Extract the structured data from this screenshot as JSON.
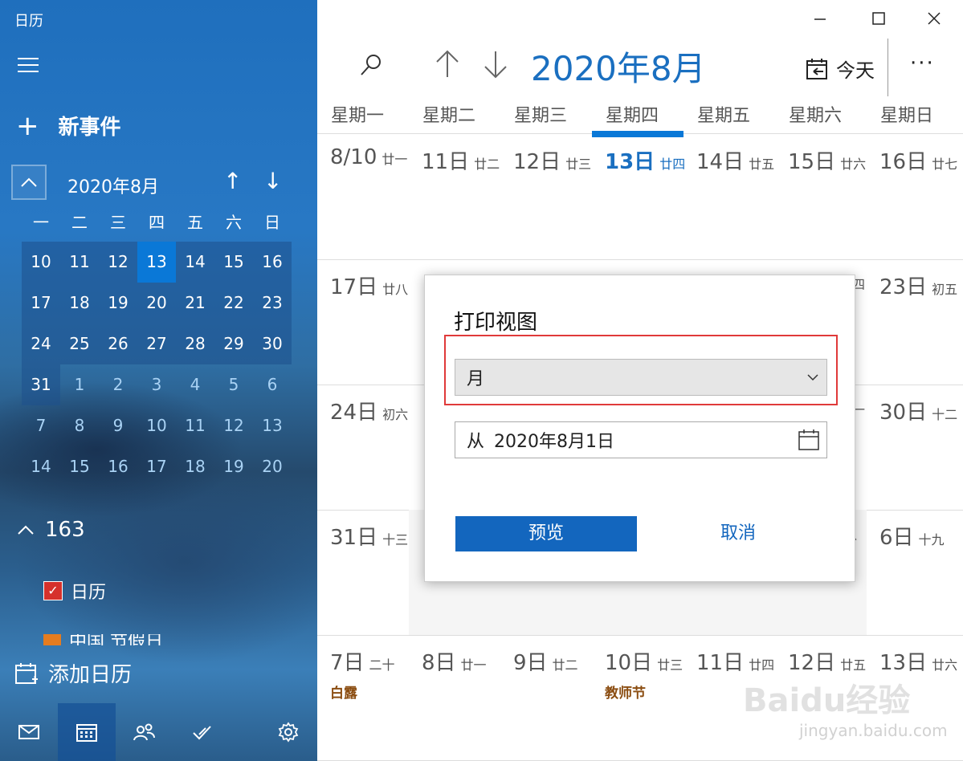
{
  "app": {
    "title": "日历"
  },
  "sidebar": {
    "new_event": "新事件",
    "mini_calendar": {
      "month_label": "2020年8月",
      "weekdays": [
        "一",
        "二",
        "三",
        "四",
        "五",
        "六",
        "日"
      ],
      "rows": [
        [
          "10",
          "11",
          "12",
          "13",
          "14",
          "15",
          "16"
        ],
        [
          "17",
          "18",
          "19",
          "20",
          "21",
          "22",
          "23"
        ],
        [
          "24",
          "25",
          "26",
          "27",
          "28",
          "29",
          "30"
        ],
        [
          "31",
          "1",
          "2",
          "3",
          "4",
          "5",
          "6"
        ],
        [
          "7",
          "8",
          "9",
          "10",
          "11",
          "12",
          "13"
        ],
        [
          "14",
          "15",
          "16",
          "17",
          "18",
          "19",
          "20"
        ]
      ]
    },
    "account": "163",
    "calendars": [
      {
        "name": "日历",
        "checked": true,
        "color": "#d6312c"
      },
      {
        "name": "中国 节假日",
        "checked": true,
        "color": "#e57c1f"
      }
    ],
    "add_calendar": "添加日历"
  },
  "header": {
    "month_title": "2020年8月",
    "today_label": "今天"
  },
  "weekdays": [
    "星期一",
    "星期二",
    "星期三",
    "星期四",
    "星期五",
    "星期六",
    "星期日"
  ],
  "weeks": [
    [
      {
        "d": "8/10",
        "l": "廿一"
      },
      {
        "d": "11日",
        "l": "廿二"
      },
      {
        "d": "12日",
        "l": "廿三"
      },
      {
        "d": "13日",
        "l": "廿四"
      },
      {
        "d": "14日",
        "l": "廿五"
      },
      {
        "d": "15日",
        "l": "廿六"
      },
      {
        "d": "16日",
        "l": "廿七"
      }
    ],
    [
      {
        "d": "17日",
        "l": "廿八"
      },
      {
        "d": "",
        "l": ""
      },
      {
        "d": "",
        "l": ""
      },
      {
        "d": "",
        "l": ""
      },
      {
        "d": "",
        "l": ""
      },
      {
        "d": "",
        "l": "四"
      },
      {
        "d": "23日",
        "l": "初五"
      }
    ],
    [
      {
        "d": "24日",
        "l": "初六"
      },
      {
        "d": "",
        "l": ""
      },
      {
        "d": "",
        "l": ""
      },
      {
        "d": "",
        "l": ""
      },
      {
        "d": "",
        "l": ""
      },
      {
        "d": "",
        "l": "一"
      },
      {
        "d": "30日",
        "l": "十二"
      }
    ],
    [
      {
        "d": "31日",
        "l": "十三"
      },
      {
        "d": "",
        "l": ""
      },
      {
        "d": "",
        "l": ""
      },
      {
        "d": "",
        "l": ""
      },
      {
        "d": "",
        "l": ""
      },
      {
        "d": "",
        "l": "、"
      },
      {
        "d": "6日",
        "l": "十九"
      }
    ],
    [
      {
        "d": "7日",
        "l": "二十",
        "h": "白露"
      },
      {
        "d": "8日",
        "l": "廿一"
      },
      {
        "d": "9日",
        "l": "廿二"
      },
      {
        "d": "10日",
        "l": "廿三",
        "h": "教师节"
      },
      {
        "d": "11日",
        "l": "廿四"
      },
      {
        "d": "12日",
        "l": "廿五"
      },
      {
        "d": "13日",
        "l": "廿六"
      }
    ]
  ],
  "dialog": {
    "title": "打印视图",
    "view_select": "月",
    "from_label": "从",
    "from_date": "2020年8月1日",
    "preview_button": "预览",
    "cancel_button": "取消"
  },
  "watermark": {
    "brand": "Baidu经验",
    "url": "jingyan.baidu.com"
  }
}
